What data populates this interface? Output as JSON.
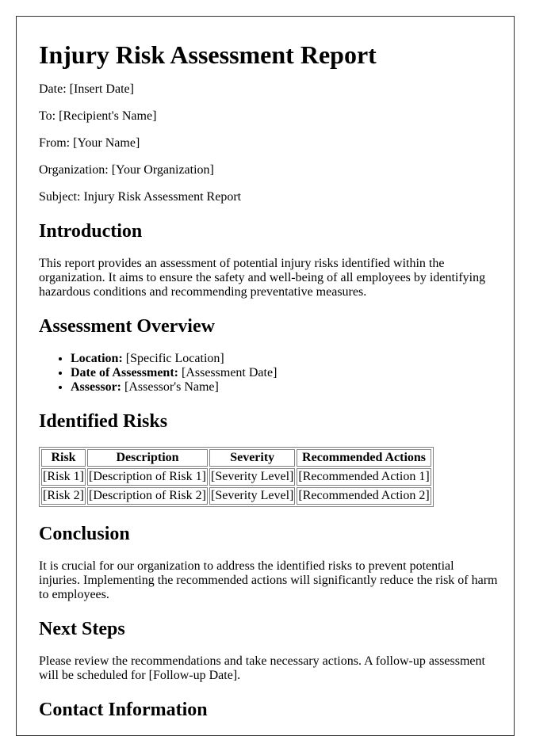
{
  "document": {
    "title": "Injury Risk Assessment Report",
    "meta": [
      {
        "label": "Date:",
        "value": "[Insert Date]"
      },
      {
        "label": "To:",
        "value": "[Recipient's Name]"
      },
      {
        "label": "From:",
        "value": "[Your Name]"
      },
      {
        "label": "Organization:",
        "value": "[Your Organization]"
      },
      {
        "label": "Subject:",
        "value": "Injury Risk Assessment Report"
      }
    ],
    "introduction": {
      "heading": "Introduction",
      "text": "This report provides an assessment of potential injury risks identified within the organization. It aims to ensure the safety and well-being of all employees by identifying hazardous conditions and recommending preventative measures."
    },
    "overview": {
      "heading": "Assessment Overview",
      "items": [
        {
          "label": "Location:",
          "value": "[Specific Location]"
        },
        {
          "label": "Date of Assessment:",
          "value": "[Assessment Date]"
        },
        {
          "label": "Assessor:",
          "value": "[Assessor's Name]"
        }
      ]
    },
    "risks": {
      "heading": "Identified Risks",
      "columns": [
        "Risk",
        "Description",
        "Severity",
        "Recommended Actions"
      ],
      "rows": [
        [
          "[Risk 1]",
          "[Description of Risk 1]",
          "[Severity Level]",
          "[Recommended Action 1]"
        ],
        [
          "[Risk 2]",
          "[Description of Risk 2]",
          "[Severity Level]",
          "[Recommended Action 2]"
        ]
      ]
    },
    "conclusion": {
      "heading": "Conclusion",
      "text": "It is crucial for our organization to address the identified risks to prevent potential injuries. Implementing the recommended actions will significantly reduce the risk of harm to employees."
    },
    "next_steps": {
      "heading": "Next Steps",
      "text": "Please review the recommendations and take necessary actions. A follow-up assessment will be scheduled for [Follow-up Date]."
    },
    "contact": {
      "heading": "Contact Information"
    }
  }
}
